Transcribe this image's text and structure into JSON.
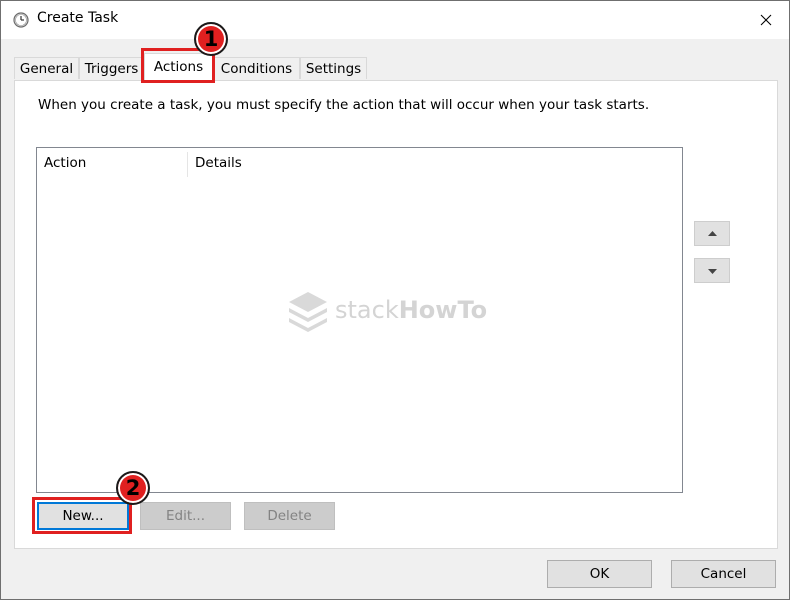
{
  "window": {
    "title": "Create Task"
  },
  "tabs": [
    {
      "label": "General"
    },
    {
      "label": "Triggers"
    },
    {
      "label": "Actions"
    },
    {
      "label": "Conditions"
    },
    {
      "label": "Settings"
    }
  ],
  "active_tab": "Actions",
  "actions_panel": {
    "description": "When you create a task, you must specify the action that will occur when your task starts.",
    "columns": [
      "Action",
      "Details"
    ],
    "rows": []
  },
  "watermark": {
    "part1": "stack",
    "part2": "HowTo"
  },
  "buttons": {
    "new": "New...",
    "edit": "Edit...",
    "delete": "Delete",
    "ok": "OK",
    "cancel": "Cancel"
  },
  "annotations": [
    {
      "number": "1"
    },
    {
      "number": "2"
    }
  ],
  "colors": {
    "callout": "#e02020",
    "focus": "#0078d7"
  }
}
